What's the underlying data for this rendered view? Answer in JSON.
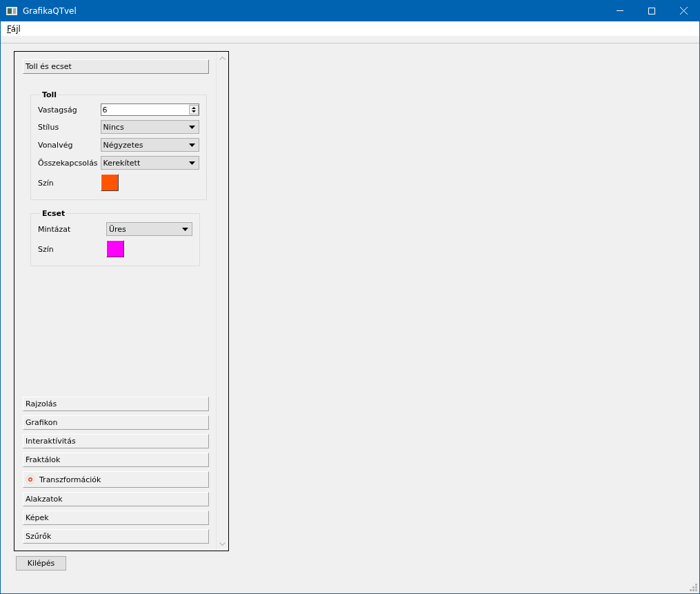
{
  "window": {
    "title": "GrafikaQTvel"
  },
  "menu": [
    {
      "label": "Fájl"
    }
  ],
  "toolbox": {
    "pages": [
      {
        "title": "Toll és ecset",
        "selected": true,
        "icon": false
      },
      {
        "title": "Rajzolás",
        "selected": false,
        "icon": false
      },
      {
        "title": "Grafikon",
        "selected": false,
        "icon": false
      },
      {
        "title": "Interaktívitás",
        "selected": false,
        "icon": false
      },
      {
        "title": "Fraktálok",
        "selected": false,
        "icon": false
      },
      {
        "title": "Transzformációk",
        "selected": false,
        "icon": true
      },
      {
        "title": "Alakzatok",
        "selected": false,
        "icon": false
      },
      {
        "title": "Képek",
        "selected": false,
        "icon": false
      },
      {
        "title": "Szűrők",
        "selected": false,
        "icon": false
      }
    ],
    "groups": [
      {
        "title": "Toll",
        "rows": [
          {
            "kind": "spin",
            "label": "Vastagság",
            "value": "6"
          },
          {
            "kind": "combo",
            "label": "Stílus",
            "value": "Nincs"
          },
          {
            "kind": "combo",
            "label": "Vonalvég",
            "value": "Négyzetes"
          },
          {
            "kind": "combo",
            "label": "Összekapcsolás",
            "value": "Kerekített"
          },
          {
            "kind": "color",
            "label": "Szín",
            "color": "#ff5500"
          }
        ]
      },
      {
        "title": "Ecset",
        "rows": [
          {
            "kind": "combo",
            "label": "Mintázat",
            "value": "Üres"
          },
          {
            "kind": "color",
            "label": "Szín",
            "color": "#ff00ff"
          }
        ]
      }
    ]
  },
  "buttons": [
    {
      "label": "Kilépés"
    }
  ]
}
